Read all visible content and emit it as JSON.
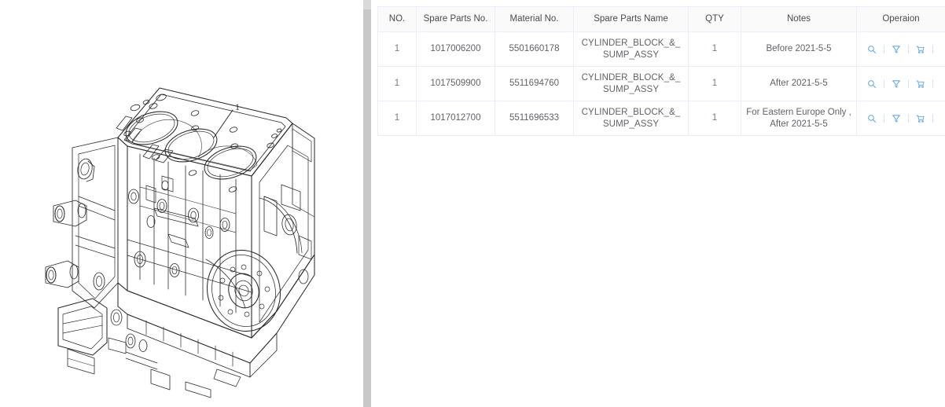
{
  "left_pane": {
    "name": "engine-cylinder-block-diagram",
    "callouts": [
      {
        "label": "1"
      }
    ]
  },
  "divider": {
    "name": "vertical-scrollbar"
  },
  "table": {
    "columns": [
      {
        "key": "no",
        "label": "NO."
      },
      {
        "key": "part_no",
        "label": "Spare Parts No."
      },
      {
        "key": "material",
        "label": "Material No."
      },
      {
        "key": "name",
        "label": "Spare Parts Name"
      },
      {
        "key": "qty",
        "label": "QTY"
      },
      {
        "key": "notes",
        "label": "Notes"
      },
      {
        "key": "oper",
        "label": "Operaion"
      }
    ],
    "rows": [
      {
        "no": "1",
        "part_no": "1017006200",
        "material": "5501660178",
        "name": "CYLINDER_BLOCK_&_SUMP_ASSY",
        "qty": "1",
        "notes": "Before 2021-5-5"
      },
      {
        "no": "1",
        "part_no": "1017509900",
        "material": "5511694760",
        "name": "CYLINDER_BLOCK_&_SUMP_ASSY",
        "qty": "1",
        "notes": "After 2021-5-5"
      },
      {
        "no": "1",
        "part_no": "1017012700",
        "material": "5511696533",
        "name": "CYLINDER_BLOCK_&_SUMP_ASSY",
        "qty": "1",
        "notes": "For Eastern Europe Only ,After 2021-5-5"
      }
    ],
    "operation_icons": [
      {
        "name": "search-icon",
        "glyph": "search"
      },
      {
        "name": "filter-funnel-icon",
        "glyph": "funnel"
      },
      {
        "name": "shopping-cart-icon",
        "glyph": "cart"
      }
    ]
  },
  "colors": {
    "icon_blue": "#66a7e0",
    "border": "#ebeef5",
    "header_bg": "#fafafa",
    "text": "#606266",
    "scrollbar": "#c8c8c8"
  }
}
